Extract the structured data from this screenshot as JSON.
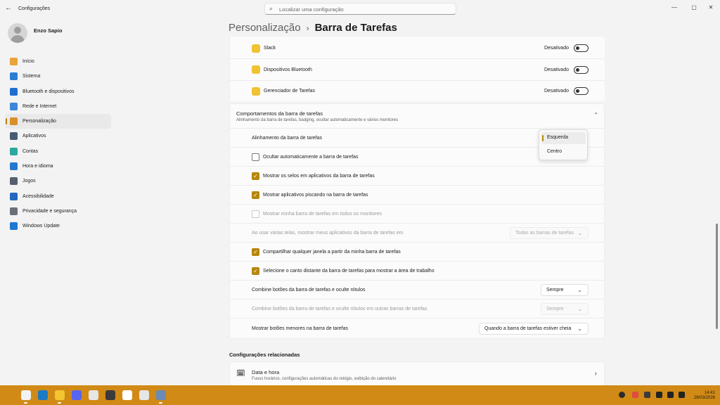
{
  "window": {
    "title": "Configurações",
    "search_placeholder": "Localizar uma configuração",
    "minimize": "—",
    "maximize": "▢",
    "close": "✕"
  },
  "user": {
    "name": "Enzo Sapio"
  },
  "nav": [
    {
      "label": "Início",
      "icon": "home-icon",
      "color": "#e8a33a"
    },
    {
      "label": "Sistema",
      "icon": "system-icon",
      "color": "#2a7fd4"
    },
    {
      "label": "Bluetooth e dispositivos",
      "icon": "bluetooth-icon",
      "color": "#1e6fd0"
    },
    {
      "label": "Rede e Internet",
      "icon": "wifi-icon",
      "color": "#3a86d8"
    },
    {
      "label": "Personalização",
      "icon": "brush-icon",
      "color": "#d9902a",
      "active": true
    },
    {
      "label": "Aplicativos",
      "icon": "apps-icon",
      "color": "#4a5a73"
    },
    {
      "label": "Contas",
      "icon": "person-icon",
      "color": "#2fa7a0"
    },
    {
      "label": "Hora e idioma",
      "icon": "globe-clock-icon",
      "color": "#2478cf"
    },
    {
      "label": "Jogos",
      "icon": "gamepad-icon",
      "color": "#555f6d"
    },
    {
      "label": "Acessibilidade",
      "icon": "accessibility-icon",
      "color": "#2467c2"
    },
    {
      "label": "Privacidade e segurança",
      "icon": "shield-icon",
      "color": "#6b6f78"
    },
    {
      "label": "Windows Update",
      "icon": "windows-update-icon",
      "color": "#1f78d1"
    }
  ],
  "breadcrumb": {
    "parent": "Personalização",
    "separator": "›",
    "current": "Barra de Tarefas"
  },
  "overflow_apps": [
    {
      "label": "Slack",
      "icon": "slack-icon",
      "state": "Desativado"
    },
    {
      "label": "Dispositivos Bluetooth",
      "icon": "bluetooth-icon",
      "state": "Desativado"
    },
    {
      "label": "Gerenciador de Tarefas",
      "icon": "task-manager-icon",
      "state": "Desativado"
    }
  ],
  "behaviors": {
    "title": "Comportamentos da barra de tarefas",
    "subtitle": "Alinhamento da barra de tarefas, badging, ocultar automaticamente e vários monitores",
    "alignment_label": "Alinhamento da barra de tarefas",
    "alignment_options": [
      "Esquerda",
      "Centro"
    ],
    "alignment_selected": "Esquerda",
    "checkboxes": [
      {
        "label": "Ocultar automaticamente a barra de tarefas",
        "checked": false,
        "disabled": false
      },
      {
        "label": "Mostrar os selos em aplicativos da barra de tarefas",
        "checked": true,
        "disabled": false
      },
      {
        "label": "Mostrar aplicativos piscando na barra de tarefas",
        "checked": true,
        "disabled": false
      },
      {
        "label": "Mostrar minha barra de tarefas em todos os monitores",
        "checked": false,
        "disabled": true
      }
    ],
    "multi_monitor_label": "Ao usar várias telas, mostrar meus aplicativos da barra de tarefas em",
    "multi_monitor_value": "Todas as barras de tarefas",
    "checkboxes2": [
      {
        "label": "Compartilhar qualquer janela a partir da minha barra de tarefas",
        "checked": true
      },
      {
        "label": "Selecione o canto distante da barra de tarefas para mostrar a área de trabalho",
        "checked": true
      }
    ],
    "combine_label": "Combine botões da barra de tarefas e oculte rótulos",
    "combine_value": "Sempre",
    "combine_other_label": "Combine botões da barra de tarefas e oculte rótulos em outras barras de tarefas",
    "combine_other_value": "Sempre",
    "small_buttons_label": "Mostrar botões menores na barra de tarefas",
    "small_buttons_value": "Quando a barra de tarefas estiver cheia"
  },
  "related": {
    "title": "Configurações relacionadas",
    "item_title": "Data e hora",
    "item_subtitle": "Fusos horários, configurações automáticas do relógio, exibição do calendário"
  },
  "taskbar": {
    "time": "14:41",
    "date": "28/03/2026",
    "apps": [
      {
        "icon": "file-manager-icon",
        "color": "#f2f2f2"
      },
      {
        "icon": "terminal-icon",
        "color": "#1a7bc4"
      },
      {
        "icon": "folder-icon",
        "color": "#f3c530"
      },
      {
        "icon": "discord-icon",
        "color": "#5865f2"
      },
      {
        "icon": "chrome-icon",
        "color": "#e6e6e6"
      },
      {
        "icon": "calculator-icon",
        "color": "#3a3a3a"
      },
      {
        "icon": "pinwheel-icon",
        "color": "#ffffff"
      },
      {
        "icon": "chrome-profile-icon",
        "color": "#e6e6e6"
      },
      {
        "icon": "settings-icon",
        "color": "#6a8bb3"
      }
    ]
  }
}
